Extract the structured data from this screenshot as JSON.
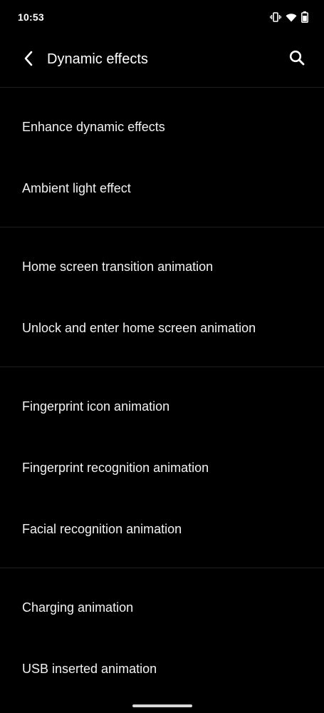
{
  "status_bar": {
    "time": "10:53",
    "icons": [
      "vibrate-icon",
      "wifi-icon",
      "battery-icon"
    ]
  },
  "app_bar": {
    "title": "Dynamic effects",
    "back_icon": "chevron-left-icon",
    "search_icon": "search-icon"
  },
  "groups": [
    {
      "items": [
        {
          "label": "Enhance dynamic effects"
        },
        {
          "label": "Ambient light effect"
        }
      ]
    },
    {
      "items": [
        {
          "label": "Home screen transition animation"
        },
        {
          "label": "Unlock and enter home screen animation"
        }
      ]
    },
    {
      "items": [
        {
          "label": "Fingerprint icon animation"
        },
        {
          "label": "Fingerprint recognition animation"
        },
        {
          "label": "Facial recognition animation"
        }
      ]
    },
    {
      "items": [
        {
          "label": "Charging animation"
        },
        {
          "label": "USB inserted animation"
        }
      ]
    }
  ],
  "colors": {
    "background": "#000000",
    "text": "#ffffff",
    "divider": "#1f1f1f"
  }
}
